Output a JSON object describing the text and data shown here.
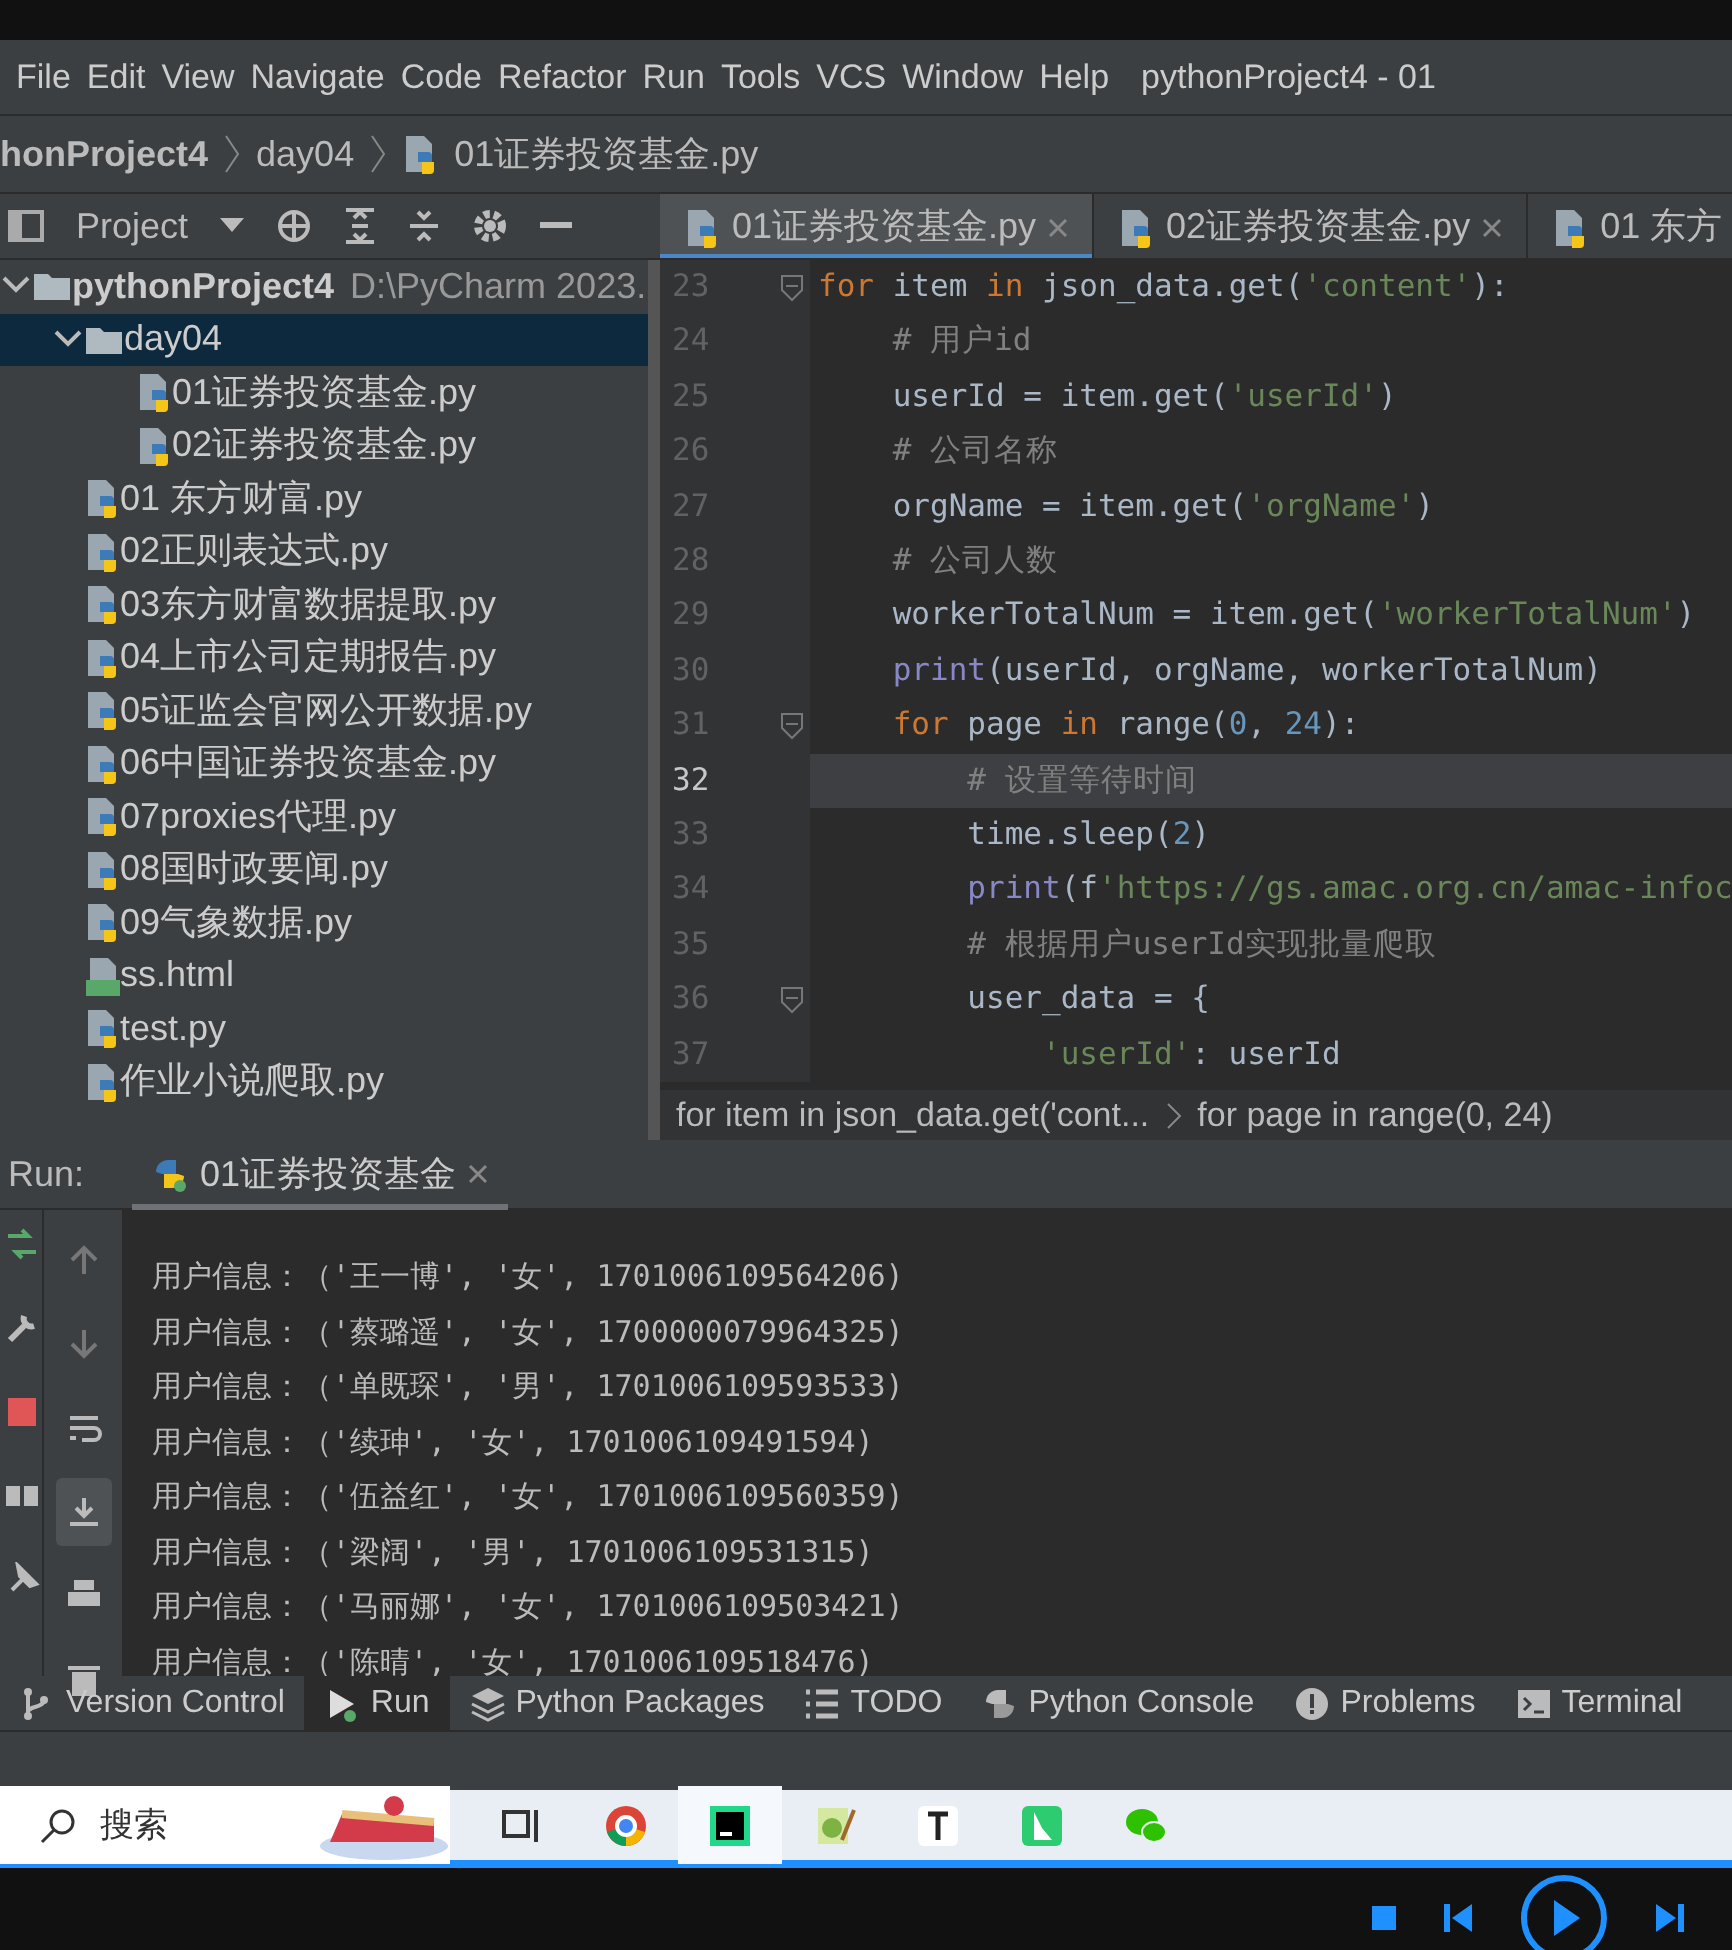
{
  "window": {
    "title": "pythonProject4 - 01"
  },
  "menu": [
    "File",
    "Edit",
    "View",
    "Navigate",
    "Code",
    "Refactor",
    "Run",
    "Tools",
    "VCS",
    "Window",
    "Help"
  ],
  "breadcrumb": [
    "honProject4",
    "day04",
    "01证券投资基金.py"
  ],
  "project_panel": {
    "title": "Project"
  },
  "editor_tabs": [
    {
      "label": "01证券投资基金.py",
      "selected": true
    },
    {
      "label": "02证券投资基金.py",
      "selected": false
    },
    {
      "label": "01 东方",
      "selected": false
    }
  ],
  "tree": [
    {
      "label": "pythonProject4",
      "path": "D:\\PyCharm 2023.",
      "kind": "folder",
      "expanded": true,
      "selected": false,
      "children": [
        {
          "label": "day04",
          "kind": "folder",
          "expanded": true,
          "selected": true,
          "children": [
            {
              "label": "01证券投资基金.py",
              "kind": "python",
              "selected": false
            },
            {
              "label": "02证券投资基金.py",
              "kind": "python",
              "selected": false
            }
          ]
        },
        {
          "label": "01 东方财富.py",
          "kind": "python",
          "selected": false
        },
        {
          "label": "02正则表达式.py",
          "kind": "python",
          "selected": false
        },
        {
          "label": "03东方财富数据提取.py",
          "kind": "python",
          "selected": false
        },
        {
          "label": "04上市公司定期报告.py",
          "kind": "python",
          "selected": false
        },
        {
          "label": "05证监会官网公开数据.py",
          "kind": "python",
          "selected": false
        },
        {
          "label": "06中国证券投资基金.py",
          "kind": "python",
          "selected": false
        },
        {
          "label": "07proxies代理.py",
          "kind": "python",
          "selected": false
        },
        {
          "label": "08国时政要闻.py",
          "kind": "python",
          "selected": false
        },
        {
          "label": "09气象数据.py",
          "kind": "python",
          "selected": false
        },
        {
          "label": "ss.html",
          "kind": "html",
          "selected": false
        },
        {
          "label": "test.py",
          "kind": "python",
          "selected": false
        },
        {
          "label": "作业小说爬取.py",
          "kind": "python",
          "selected": false
        }
      ]
    }
  ],
  "code": [
    {
      "number": "23",
      "fold": true,
      "current": false,
      "tokens": [
        {
          "text": "for",
          "kind": "keyword"
        },
        {
          "text": " item ",
          "kind": "plain"
        },
        {
          "text": "in",
          "kind": "keyword"
        },
        {
          "text": " json_data.get(",
          "kind": "plain"
        },
        {
          "text": "'content'",
          "kind": "string"
        },
        {
          "text": "):",
          "kind": "plain"
        }
      ]
    },
    {
      "number": "24",
      "fold": false,
      "current": false,
      "tokens": [
        {
          "text": "    # 用户id",
          "kind": "comment"
        }
      ]
    },
    {
      "number": "25",
      "fold": false,
      "current": false,
      "tokens": [
        {
          "text": "    userId = item.get(",
          "kind": "plain"
        },
        {
          "text": "'userId'",
          "kind": "string"
        },
        {
          "text": ")",
          "kind": "plain"
        }
      ]
    },
    {
      "number": "26",
      "fold": false,
      "current": false,
      "tokens": [
        {
          "text": "    # 公司名称",
          "kind": "comment"
        }
      ]
    },
    {
      "number": "27",
      "fold": false,
      "current": false,
      "tokens": [
        {
          "text": "    orgName = item.get(",
          "kind": "plain"
        },
        {
          "text": "'orgName'",
          "kind": "string"
        },
        {
          "text": ")",
          "kind": "plain"
        }
      ]
    },
    {
      "number": "28",
      "fold": false,
      "current": false,
      "tokens": [
        {
          "text": "    # 公司人数",
          "kind": "comment"
        }
      ]
    },
    {
      "number": "29",
      "fold": false,
      "current": false,
      "tokens": [
        {
          "text": "    workerTotalNum = item.get(",
          "kind": "plain"
        },
        {
          "text": "'workerTotalNum'",
          "kind": "string"
        },
        {
          "text": ")",
          "kind": "plain"
        }
      ]
    },
    {
      "number": "30",
      "fold": false,
      "current": false,
      "tokens": [
        {
          "text": "    print",
          "kind": "builtin"
        },
        {
          "text": "(userId, orgName, workerTotalNum)",
          "kind": "plain"
        }
      ]
    },
    {
      "number": "31",
      "fold": true,
      "current": false,
      "tokens": [
        {
          "text": "    for",
          "kind": "keyword"
        },
        {
          "text": " page ",
          "kind": "plain"
        },
        {
          "text": "in",
          "kind": "keyword"
        },
        {
          "text": " range(",
          "kind": "plain"
        },
        {
          "text": "0",
          "kind": "number"
        },
        {
          "text": ", ",
          "kind": "plain"
        },
        {
          "text": "24",
          "kind": "number"
        },
        {
          "text": "):",
          "kind": "plain"
        }
      ]
    },
    {
      "number": "32",
      "fold": false,
      "current": true,
      "tokens": [
        {
          "text": "        # 设置等待时间",
          "kind": "comment"
        }
      ]
    },
    {
      "number": "33",
      "fold": false,
      "current": false,
      "tokens": [
        {
          "text": "        time.sleep(",
          "kind": "plain"
        },
        {
          "text": "2",
          "kind": "number"
        },
        {
          "text": ")",
          "kind": "plain"
        }
      ]
    },
    {
      "number": "34",
      "fold": false,
      "current": false,
      "tokens": [
        {
          "text": "        print",
          "kind": "builtin"
        },
        {
          "text": "(f",
          "kind": "plain"
        },
        {
          "text": "'https://gs.amac.org.cn/amac-infoc",
          "kind": "string"
        }
      ]
    },
    {
      "number": "35",
      "fold": false,
      "current": false,
      "tokens": [
        {
          "text": "        # 根据用户userId实现批量爬取",
          "kind": "comment"
        }
      ]
    },
    {
      "number": "36",
      "fold": true,
      "current": false,
      "tokens": [
        {
          "text": "        user_data = {",
          "kind": "plain"
        }
      ]
    },
    {
      "number": "37",
      "fold": false,
      "current": false,
      "tokens": [
        {
          "text": "            'userId'",
          "kind": "string"
        },
        {
          "text": ": userId",
          "kind": "plain"
        }
      ]
    }
  ],
  "code_breadcrumb": [
    "for item in json_data.get('cont...",
    "for page in range(0, 24)"
  ],
  "run": {
    "label": "Run:",
    "tab": "01证券投资基金",
    "output": [
      "用户信息：（'王一博', '女', 1701006109564206)",
      "用户信息：（'蔡璐遥', '女', 1700000079964325)",
      "用户信息：（'单既琛', '男', 1701006109593533)",
      "用户信息：（'续珅', '女', 1701006109491594)",
      "用户信息：（'伍益红', '女', 1701006109560359)",
      "用户信息：（'梁阔', '男', 1701006109531315)",
      "用户信息：（'马丽娜', '女', 1701006109503421)",
      "用户信息：（'陈晴', '女', 1701006109518476)"
    ]
  },
  "tool_tabs": [
    {
      "label": "Version Control",
      "selected": false
    },
    {
      "label": "Run",
      "selected": true
    },
    {
      "label": "Python Packages",
      "selected": false
    },
    {
      "label": "TODO",
      "selected": false
    },
    {
      "label": "Python Console",
      "selected": false
    },
    {
      "label": "Problems",
      "selected": false
    },
    {
      "label": "Terminal",
      "selected": false
    }
  ],
  "taskbar": {
    "search": "搜索"
  }
}
